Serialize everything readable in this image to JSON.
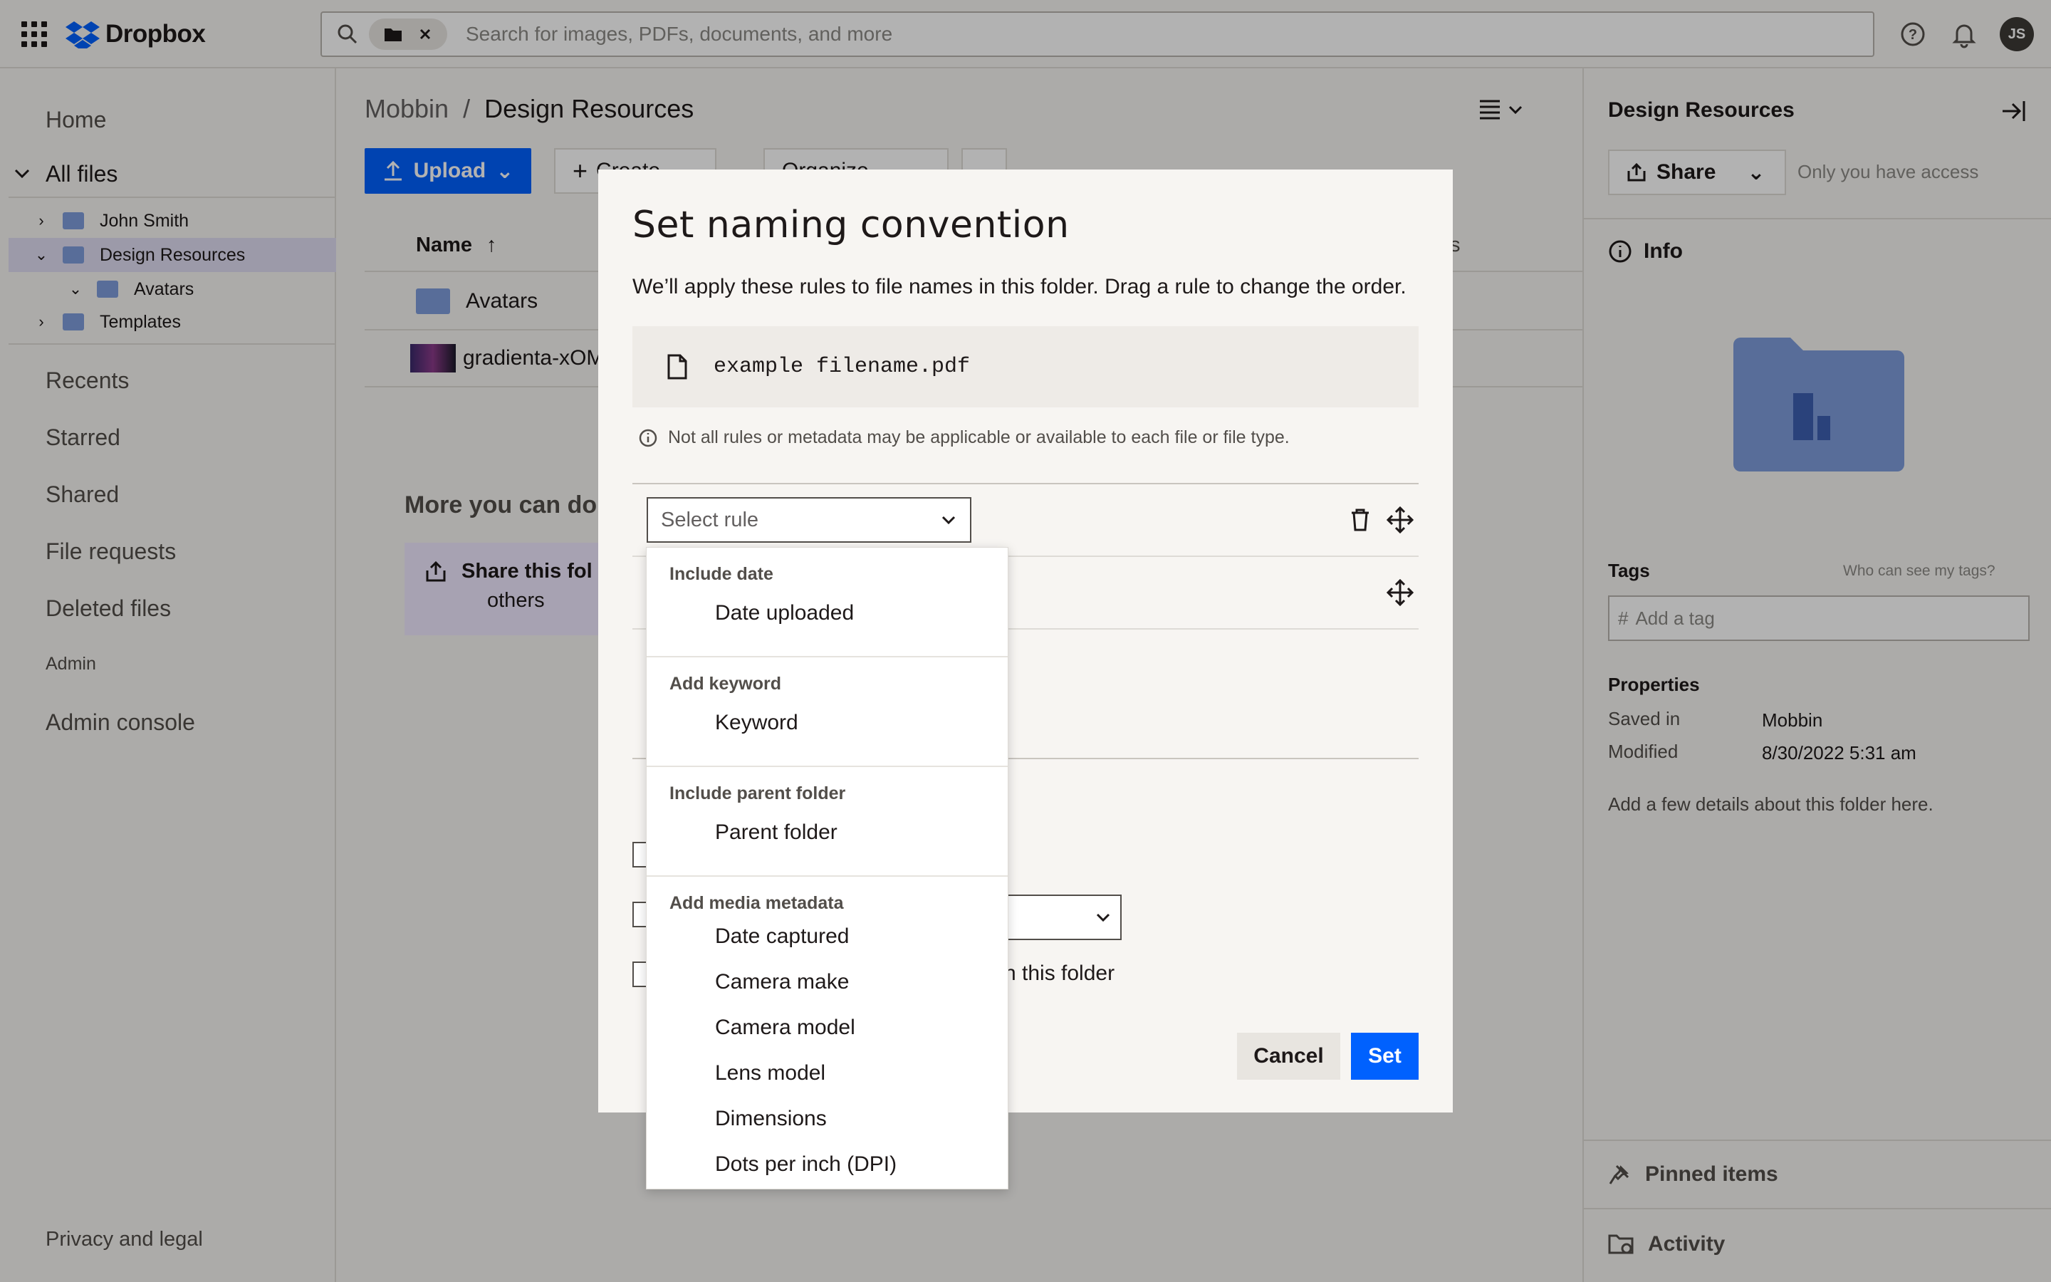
{
  "app": {
    "name": "Dropbox",
    "avatar_initials": "JS"
  },
  "search": {
    "placeholder": "Search for images, PDFs, documents, and more"
  },
  "leftnav": {
    "home": "Home",
    "all_files": "All files",
    "tree": [
      {
        "label": "John Smith"
      },
      {
        "label": "Design Resources"
      },
      {
        "label": "Avatars"
      },
      {
        "label": "Templates"
      }
    ],
    "recents": "Recents",
    "starred": "Starred",
    "shared": "Shared",
    "file_requests": "File requests",
    "deleted_files": "Deleted files",
    "admin": "Admin",
    "admin_console": "Admin console",
    "privacy": "Privacy and legal"
  },
  "main": {
    "breadcrumb_root": "Mobbin",
    "breadcrumb_sep": "/",
    "breadcrumb_current": "Design Resources",
    "upload": "Upload",
    "create": "Create",
    "organize": "Organize",
    "more": "...",
    "col_name": "Name",
    "col_right": "s",
    "files": [
      {
        "name": "Avatars"
      },
      {
        "name": "gradienta-xOM"
      }
    ],
    "more_title": "More you can do i",
    "share_card_title": "Share this fol",
    "share_card_sub": "others"
  },
  "rightpanel": {
    "title": "Design Resources",
    "share": "Share",
    "access": "Only you have access",
    "info": "Info",
    "tags": "Tags",
    "tags_help": "Who can see my tags?",
    "tag_placeholder": "Add a tag",
    "properties": "Properties",
    "saved_in_label": "Saved in",
    "saved_in_value": "Mobbin",
    "modified_label": "Modified",
    "modified_value": "8/30/2022 5:31 am",
    "details": "Add a few details about this folder here.",
    "pinned": "Pinned items",
    "activity": "Activity"
  },
  "modal": {
    "title": "Set naming convention",
    "description": "We’ll apply these rules to file names in this folder. Drag a rule to change the order.",
    "example_filename": "example filename.pdf",
    "note": "Not all rules or metadata may be applicable or available to each file or file type.",
    "select_placeholder": "Select rule",
    "behind_text": "n this folder",
    "cancel": "Cancel",
    "set": "Set"
  },
  "dropdown": {
    "groups": [
      {
        "header": "Include date",
        "items": [
          "Date uploaded"
        ]
      },
      {
        "header": "Add keyword",
        "items": [
          "Keyword"
        ]
      },
      {
        "header": "Include parent folder",
        "items": [
          "Parent folder"
        ]
      },
      {
        "header": "Add media metadata",
        "items": [
          "Date captured",
          "Camera make",
          "Camera model",
          "Lens model",
          "Dimensions",
          "Dots per inch (DPI)"
        ]
      }
    ]
  },
  "colors": {
    "accent": "#0061fe",
    "selected_row": "#e0ddf3",
    "folder": "#7f9ddb"
  }
}
